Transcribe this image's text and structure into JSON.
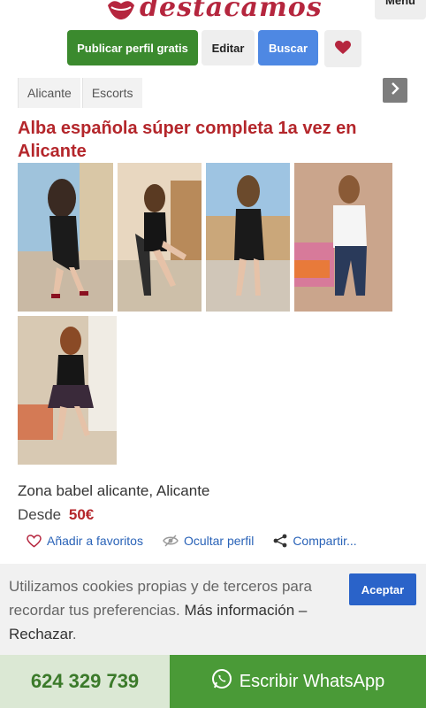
{
  "header": {
    "logo_text": "destacamos",
    "menu_label": "Menu",
    "brand_color": "#b5263e"
  },
  "actions": {
    "publish_label": "Publicar perfil gratis",
    "edit_label": "Editar",
    "search_label": "Buscar",
    "favorites_icon": "heart-icon"
  },
  "breadcrumb": {
    "items": [
      "Alicante",
      "Escorts"
    ],
    "next_icon": "chevron-right-icon"
  },
  "listing": {
    "title": "Alba española súper completa 1a vez en Alicante",
    "photos": [
      "photo-1",
      "photo-2",
      "photo-3",
      "photo-4",
      "photo-5"
    ],
    "location": "Zona babel alicante, Alicante",
    "price_prefix": "Desde",
    "price": "50€"
  },
  "tools": {
    "favorite_label": "Añadir a favoritos",
    "hide_label": "Ocultar perfil",
    "share_label": "Compartir..."
  },
  "cookie": {
    "text_main": "Utilizamos cookies propias y de terceros para recordar tus preferencias.",
    "more_info": "Más información",
    "separator": " – ",
    "reject": "Rechazar",
    "period": ".",
    "accept_label": "Aceptar"
  },
  "contact": {
    "phone": "624 329 739",
    "whatsapp_label": "Escribir WhatsApp"
  },
  "colors": {
    "accent_red": "#b4262b",
    "green": "#3b8a2e",
    "blue": "#4e88e3",
    "link_blue": "#2a63b8"
  }
}
